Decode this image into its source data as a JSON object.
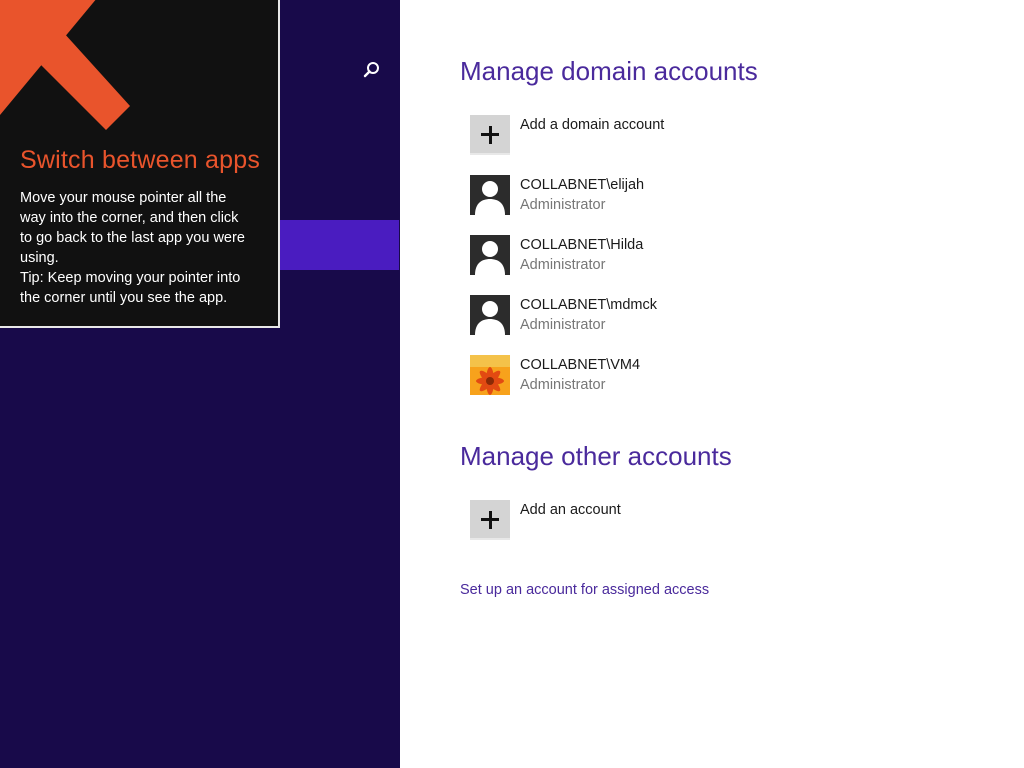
{
  "tip": {
    "title": "Switch between apps",
    "body_lines": [
      "Move your mouse pointer all the",
      "way into the corner, and then click",
      "to go back to the last app you were",
      "using.",
      "Tip: Keep moving your pointer into",
      "the corner until you see the app."
    ],
    "accent_color": "#e9542c"
  },
  "nav": {
    "search_icon": "search-icon",
    "background_color": "#180a4a",
    "selected_color": "#4a1cc0"
  },
  "domain_section": {
    "title": "Manage domain accounts",
    "add_label": "Add a domain account",
    "accounts": [
      {
        "name": "COLLABNET\\elijah",
        "role": "Administrator",
        "avatar": "user-silhouette-icon"
      },
      {
        "name": "COLLABNET\\Hilda",
        "role": "Administrator",
        "avatar": "user-silhouette-icon"
      },
      {
        "name": "COLLABNET\\mdmck",
        "role": "Administrator",
        "avatar": "user-silhouette-icon"
      },
      {
        "name": "COLLABNET\\VM4",
        "role": "Administrator",
        "avatar": "flower-photo"
      }
    ]
  },
  "other_section": {
    "title": "Manage other accounts",
    "add_label": "Add an account"
  },
  "assigned_access_link": "Set up an account for assigned access",
  "accent_text_color": "#4a2a9c"
}
